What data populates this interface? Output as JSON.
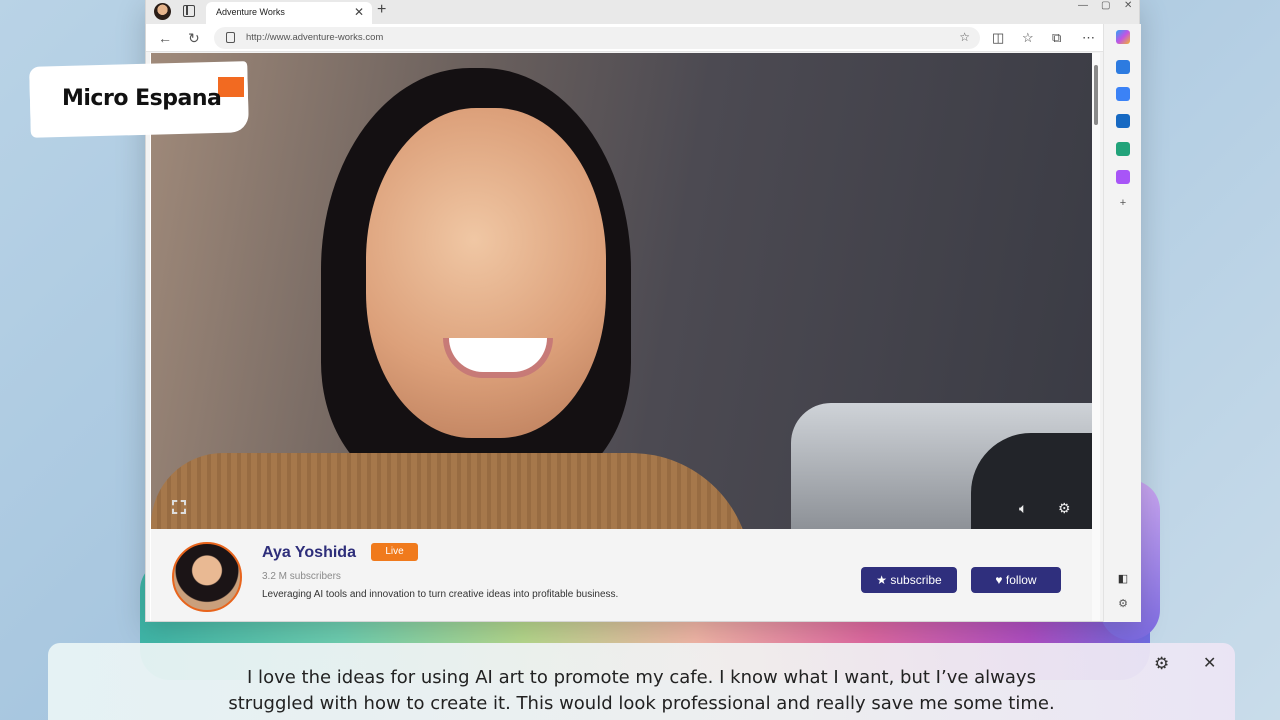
{
  "browser": {
    "tab_title": "Adventure Works",
    "url": "http://www.adventure-works.com"
  },
  "logo": {
    "text": "Micro Espana"
  },
  "channel": {
    "name": "Aya Yoshida",
    "status_badge": "Live",
    "subscribers": "3.2 M subscribers",
    "description": "Leveraging AI tools and innovation to turn creative ideas into profitable business.",
    "subscribe_label": "subscribe",
    "follow_label": "follow"
  },
  "caption": {
    "line1": "I love the ideas for using AI art to promote my cafe. I know what I want, but I’ve always",
    "line2": "struggled with how to create it. This would look professional and really save me some time."
  },
  "colors": {
    "accent": "#2f2f7d",
    "live": "#f07a1c"
  },
  "icons": [
    "profile-icon",
    "tabs-icon",
    "close-icon",
    "plus-icon",
    "back-icon",
    "refresh-icon",
    "lock-icon",
    "favorite-icon",
    "split-screen-icon",
    "favorites-icon",
    "collections-icon",
    "more-icon",
    "copilot-icon",
    "fullscreen-icon",
    "volume-icon",
    "gear-icon",
    "star-icon",
    "heart-icon"
  ]
}
